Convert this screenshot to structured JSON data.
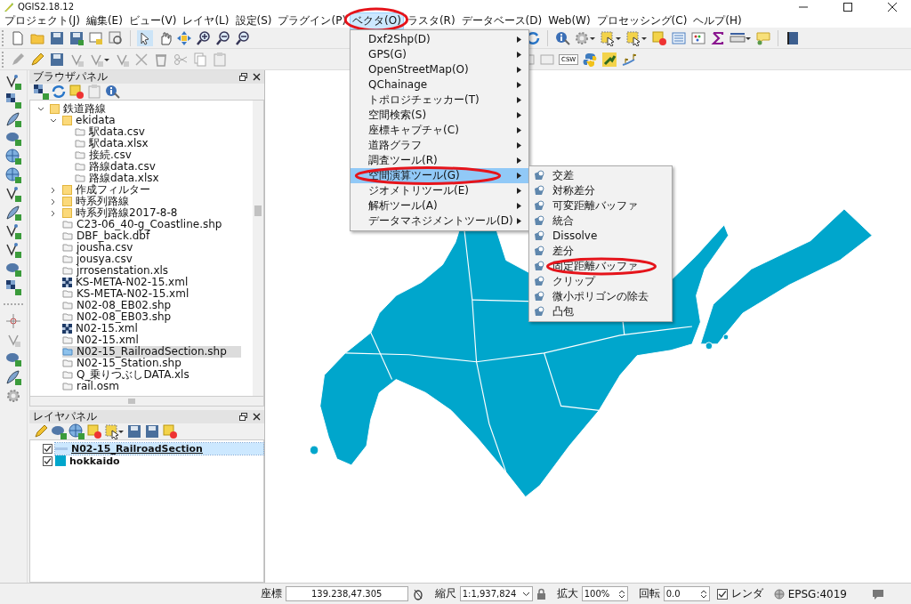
{
  "window": {
    "title": "QGIS2.18.12"
  },
  "menu_bar": [
    {
      "label": "プロジェクト(J)",
      "selected": false,
      "circled": false
    },
    {
      "label": "編集(E)",
      "selected": false,
      "circled": false
    },
    {
      "label": "ビュー(V)",
      "selected": false,
      "circled": false
    },
    {
      "label": "レイヤ(L)",
      "selected": false,
      "circled": false
    },
    {
      "label": "設定(S)",
      "selected": false,
      "circled": false
    },
    {
      "label": "プラグイン(P)",
      "selected": false,
      "circled": false
    },
    {
      "label": "ベクタ(O)",
      "selected": true,
      "circled": true
    },
    {
      "label": "ラスタ(R)",
      "selected": false,
      "circled": false
    },
    {
      "label": "データベース(D)",
      "selected": false,
      "circled": false
    },
    {
      "label": "Web(W)",
      "selected": false,
      "circled": false
    },
    {
      "label": "プロセッシング(C)",
      "selected": false,
      "circled": false
    },
    {
      "label": "ヘルプ(H)",
      "selected": false,
      "circled": false
    }
  ],
  "toolbar": {
    "csw_button": "CSW"
  },
  "vector_menu": [
    {
      "label": "Dxf2Shp(D)",
      "selected": false,
      "circled": false
    },
    {
      "label": "GPS(G)",
      "selected": false,
      "circled": false
    },
    {
      "label": "OpenStreetMap(O)",
      "selected": false,
      "circled": false
    },
    {
      "label": "QChainage",
      "selected": false,
      "circled": false
    },
    {
      "label": "トポロジチェッカー(T)",
      "selected": false,
      "circled": false
    },
    {
      "label": "空間検索(S)",
      "selected": false,
      "circled": false
    },
    {
      "label": "座標キャプチャ(C)",
      "selected": false,
      "circled": false
    },
    {
      "label": "道路グラフ",
      "selected": false,
      "circled": false
    },
    {
      "label": "調査ツール(R)",
      "selected": false,
      "circled": false
    },
    {
      "label": "空間演算ツール(G)",
      "selected": true,
      "circled": true
    },
    {
      "label": "ジオメトリツール(E)",
      "selected": false,
      "circled": false
    },
    {
      "label": "解析ツール(A)",
      "selected": false,
      "circled": false
    },
    {
      "label": "データマネジメントツール(D)",
      "selected": false,
      "circled": false
    }
  ],
  "submenu": [
    {
      "label": "交差",
      "circled": false
    },
    {
      "label": "対称差分",
      "circled": false
    },
    {
      "label": "可変距離バッファ",
      "circled": false
    },
    {
      "label": "統合",
      "circled": false
    },
    {
      "label": "Dissolve",
      "circled": false
    },
    {
      "label": "差分",
      "circled": false
    },
    {
      "label": "固定距離バッファ",
      "circled": true
    },
    {
      "label": "クリップ",
      "circled": false
    },
    {
      "label": "微小ポリゴンの除去",
      "circled": false
    },
    {
      "label": "凸包",
      "circled": false
    }
  ],
  "browser_panel": {
    "title": "ブラウザパネル",
    "tree": [
      {
        "label": "鉄道路線",
        "kind": "folder",
        "expanded": true,
        "selected": false,
        "children": [
          {
            "label": "ekidata",
            "kind": "folder",
            "expanded": true,
            "selected": false,
            "children": [
              {
                "label": "駅data.csv",
                "kind": "file",
                "selected": false
              },
              {
                "label": "駅data.xlsx",
                "kind": "file",
                "selected": false
              },
              {
                "label": "接続.csv",
                "kind": "file",
                "selected": false
              },
              {
                "label": "路線data.csv",
                "kind": "file",
                "selected": false
              },
              {
                "label": "路線data.xlsx",
                "kind": "file",
                "selected": false
              }
            ]
          },
          {
            "label": "作成フィルター",
            "kind": "folder",
            "expanded": false,
            "selected": false
          },
          {
            "label": "時系列路線",
            "kind": "folder",
            "expanded": false,
            "selected": false
          },
          {
            "label": "時系列路線2017-8-8",
            "kind": "folder",
            "expanded": false,
            "selected": false
          },
          {
            "label": "C23-06_40-g_Coastline.shp",
            "kind": "file",
            "selected": false
          },
          {
            "label": "DBF_back.dbf",
            "kind": "file",
            "selected": false
          },
          {
            "label": "jousha.csv",
            "kind": "file",
            "selected": false
          },
          {
            "label": "jousya.csv",
            "kind": "file",
            "selected": false
          },
          {
            "label": "jrrosenstation.xls",
            "kind": "file",
            "selected": false
          },
          {
            "label": "KS-META-N02-15.xml",
            "kind": "raster",
            "selected": false
          },
          {
            "label": "KS-META-N02-15.xml",
            "kind": "file",
            "selected": false
          },
          {
            "label": "N02-08_EB02.shp",
            "kind": "file",
            "selected": false
          },
          {
            "label": "N02-08_EB03.shp",
            "kind": "file",
            "selected": false
          },
          {
            "label": "N02-15.xml",
            "kind": "raster",
            "selected": false
          },
          {
            "label": "N02-15.xml",
            "kind": "file",
            "selected": false
          },
          {
            "label": "N02-15_RailroadSection.shp",
            "kind": "file",
            "selected": true
          },
          {
            "label": "N02-15_Station.shp",
            "kind": "file",
            "selected": false
          },
          {
            "label": "Q_乗りつぶしDATA.xls",
            "kind": "file",
            "selected": false
          },
          {
            "label": "rail.osm",
            "kind": "file",
            "selected": false
          }
        ]
      }
    ]
  },
  "layers_panel": {
    "title": "レイヤパネル",
    "layers": [
      {
        "name": "N02-15_RailroadSection",
        "kind": "line",
        "color": "#a9c7e8",
        "checked": true,
        "selected": true
      },
      {
        "name": "hokkaido",
        "kind": "fill",
        "color": "#00a6cc",
        "checked": true,
        "selected": false
      }
    ]
  },
  "status_bar": {
    "coordinate_label": "座標",
    "coordinate_value": "139.238,47.305",
    "scale_label": "縮尺",
    "scale_value": "1:1,937,824",
    "magnifier_label": "拡大",
    "magnifier_value": "100%",
    "rotation_label": "回転",
    "rotation_value": "0.0",
    "render": {
      "label": "レンダ",
      "checked": true
    },
    "crs": "EPSG:4019"
  }
}
